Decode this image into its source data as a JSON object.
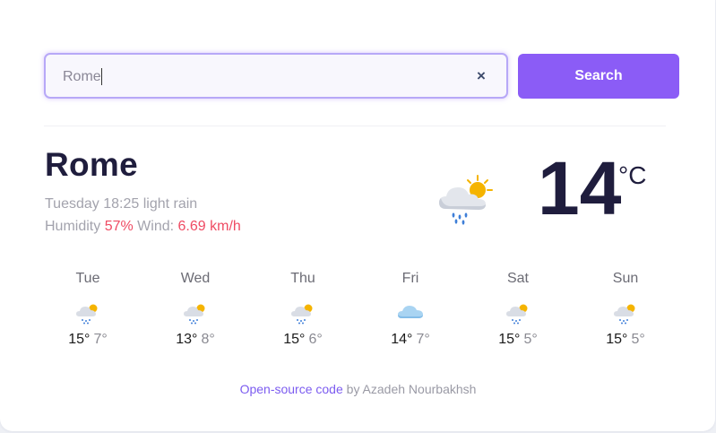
{
  "search": {
    "value": "Rome",
    "button_label": "Search",
    "clear_icon": "×"
  },
  "current": {
    "city": "Rome",
    "day_time": "Tuesday 18:25",
    "description": "light rain",
    "humidity_label": "Humidity",
    "humidity_value": "57%",
    "wind_label": "Wind:",
    "wind_value": "6.69 km/h",
    "temperature": "14",
    "unit": "°C",
    "icon": "sun-cloud-rain-icon"
  },
  "forecast": [
    {
      "day": "Tue",
      "max": "15°",
      "min": "7°",
      "icon": "sun-cloud-rain-icon"
    },
    {
      "day": "Wed",
      "max": "13°",
      "min": "8°",
      "icon": "sun-cloud-rain-icon"
    },
    {
      "day": "Thu",
      "max": "15°",
      "min": "6°",
      "icon": "sun-cloud-rain-icon"
    },
    {
      "day": "Fri",
      "max": "14°",
      "min": "7°",
      "icon": "cloud-blue-icon"
    },
    {
      "day": "Sat",
      "max": "15°",
      "min": "5°",
      "icon": "sun-cloud-rain-icon"
    },
    {
      "day": "Sun",
      "max": "15°",
      "min": "5°",
      "icon": "sun-cloud-rain-icon"
    }
  ],
  "footer": {
    "link_text": "Open-source code",
    "by_text": "by Azadeh Nourbakhsh"
  },
  "colors": {
    "accent": "#8b5cf6",
    "highlight": "#ef4b63",
    "heading": "#1f1d3d",
    "muted": "#a3a3ad"
  }
}
